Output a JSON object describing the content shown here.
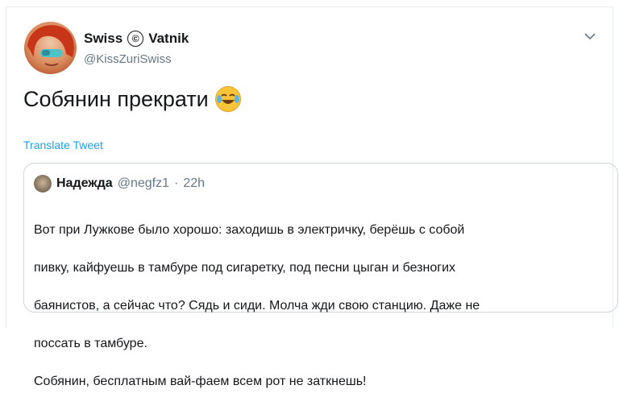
{
  "tweet": {
    "display_name_part1": "Swiss",
    "copyright_symbol": "©",
    "display_name_part2": "Vatnik",
    "handle": "@KissZuriSwiss",
    "text": "Собянин прекрати",
    "emoji": "😂",
    "translate_label": "Translate Tweet"
  },
  "quoted_tweet": {
    "display_name": "Надежда",
    "handle": "@negfz1",
    "separator": "·",
    "time": "22h",
    "text_lines": [
      "Вот при Лужкове было хорошо: заходишь  в электричку, берёшь с собой",
      "пивку, кайфуешь в тамбуре под сигаретку, под песни цыган и безногих",
      "баянистов, а сейчас что? Сядь и сиди. Молча жди свою станцию. Даже не",
      "поссать в тамбуре.",
      "Собянин, бесплатным вай-фаем всем рот не заткнешь!"
    ]
  },
  "icons": {
    "caret": "chevron-down-icon",
    "emoji": "face-with-tears-of-joy-icon"
  },
  "colors": {
    "link": "#1da1f2",
    "secondary_text": "#657786",
    "border": "#ccd6dd"
  }
}
